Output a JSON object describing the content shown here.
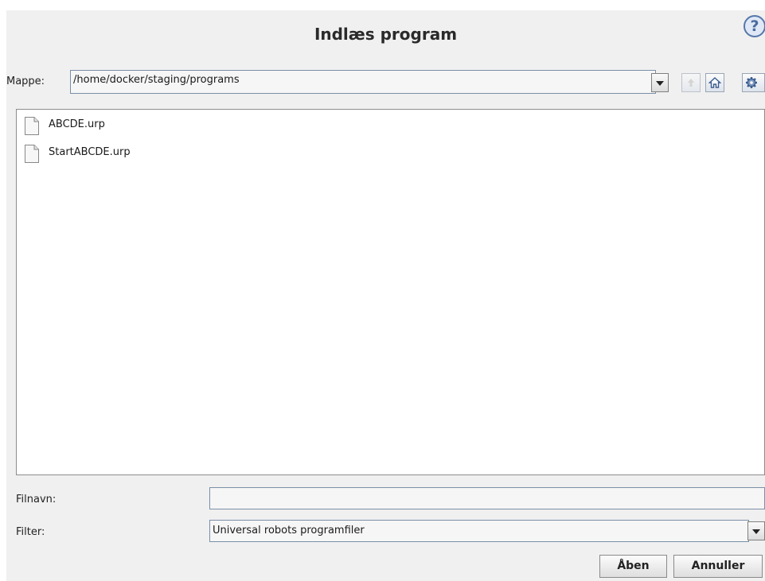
{
  "dialog": {
    "title": "Indlæs program",
    "help_icon": "help-icon",
    "help_glyph": "?"
  },
  "folder": {
    "label": "Mappe:",
    "path": "/home/docker/staging/programs",
    "icons": [
      "chevron-down-icon",
      "up-arrow-icon",
      "home-icon",
      "gear-icon"
    ]
  },
  "files": [
    {
      "name": "ABCDE.urp",
      "icon": "file-icon"
    },
    {
      "name": "StartABCDE.urp",
      "icon": "file-icon"
    }
  ],
  "filename": {
    "label": "Filnavn:",
    "value": ""
  },
  "filter": {
    "label": "Filter:",
    "selected": "Universal robots programfiler"
  },
  "buttons": {
    "open": "Åben",
    "cancel": "Annuller"
  },
  "colors": {
    "background": "#f0f0f0",
    "list_background": "#ffffff",
    "accent": "#5577aa"
  }
}
